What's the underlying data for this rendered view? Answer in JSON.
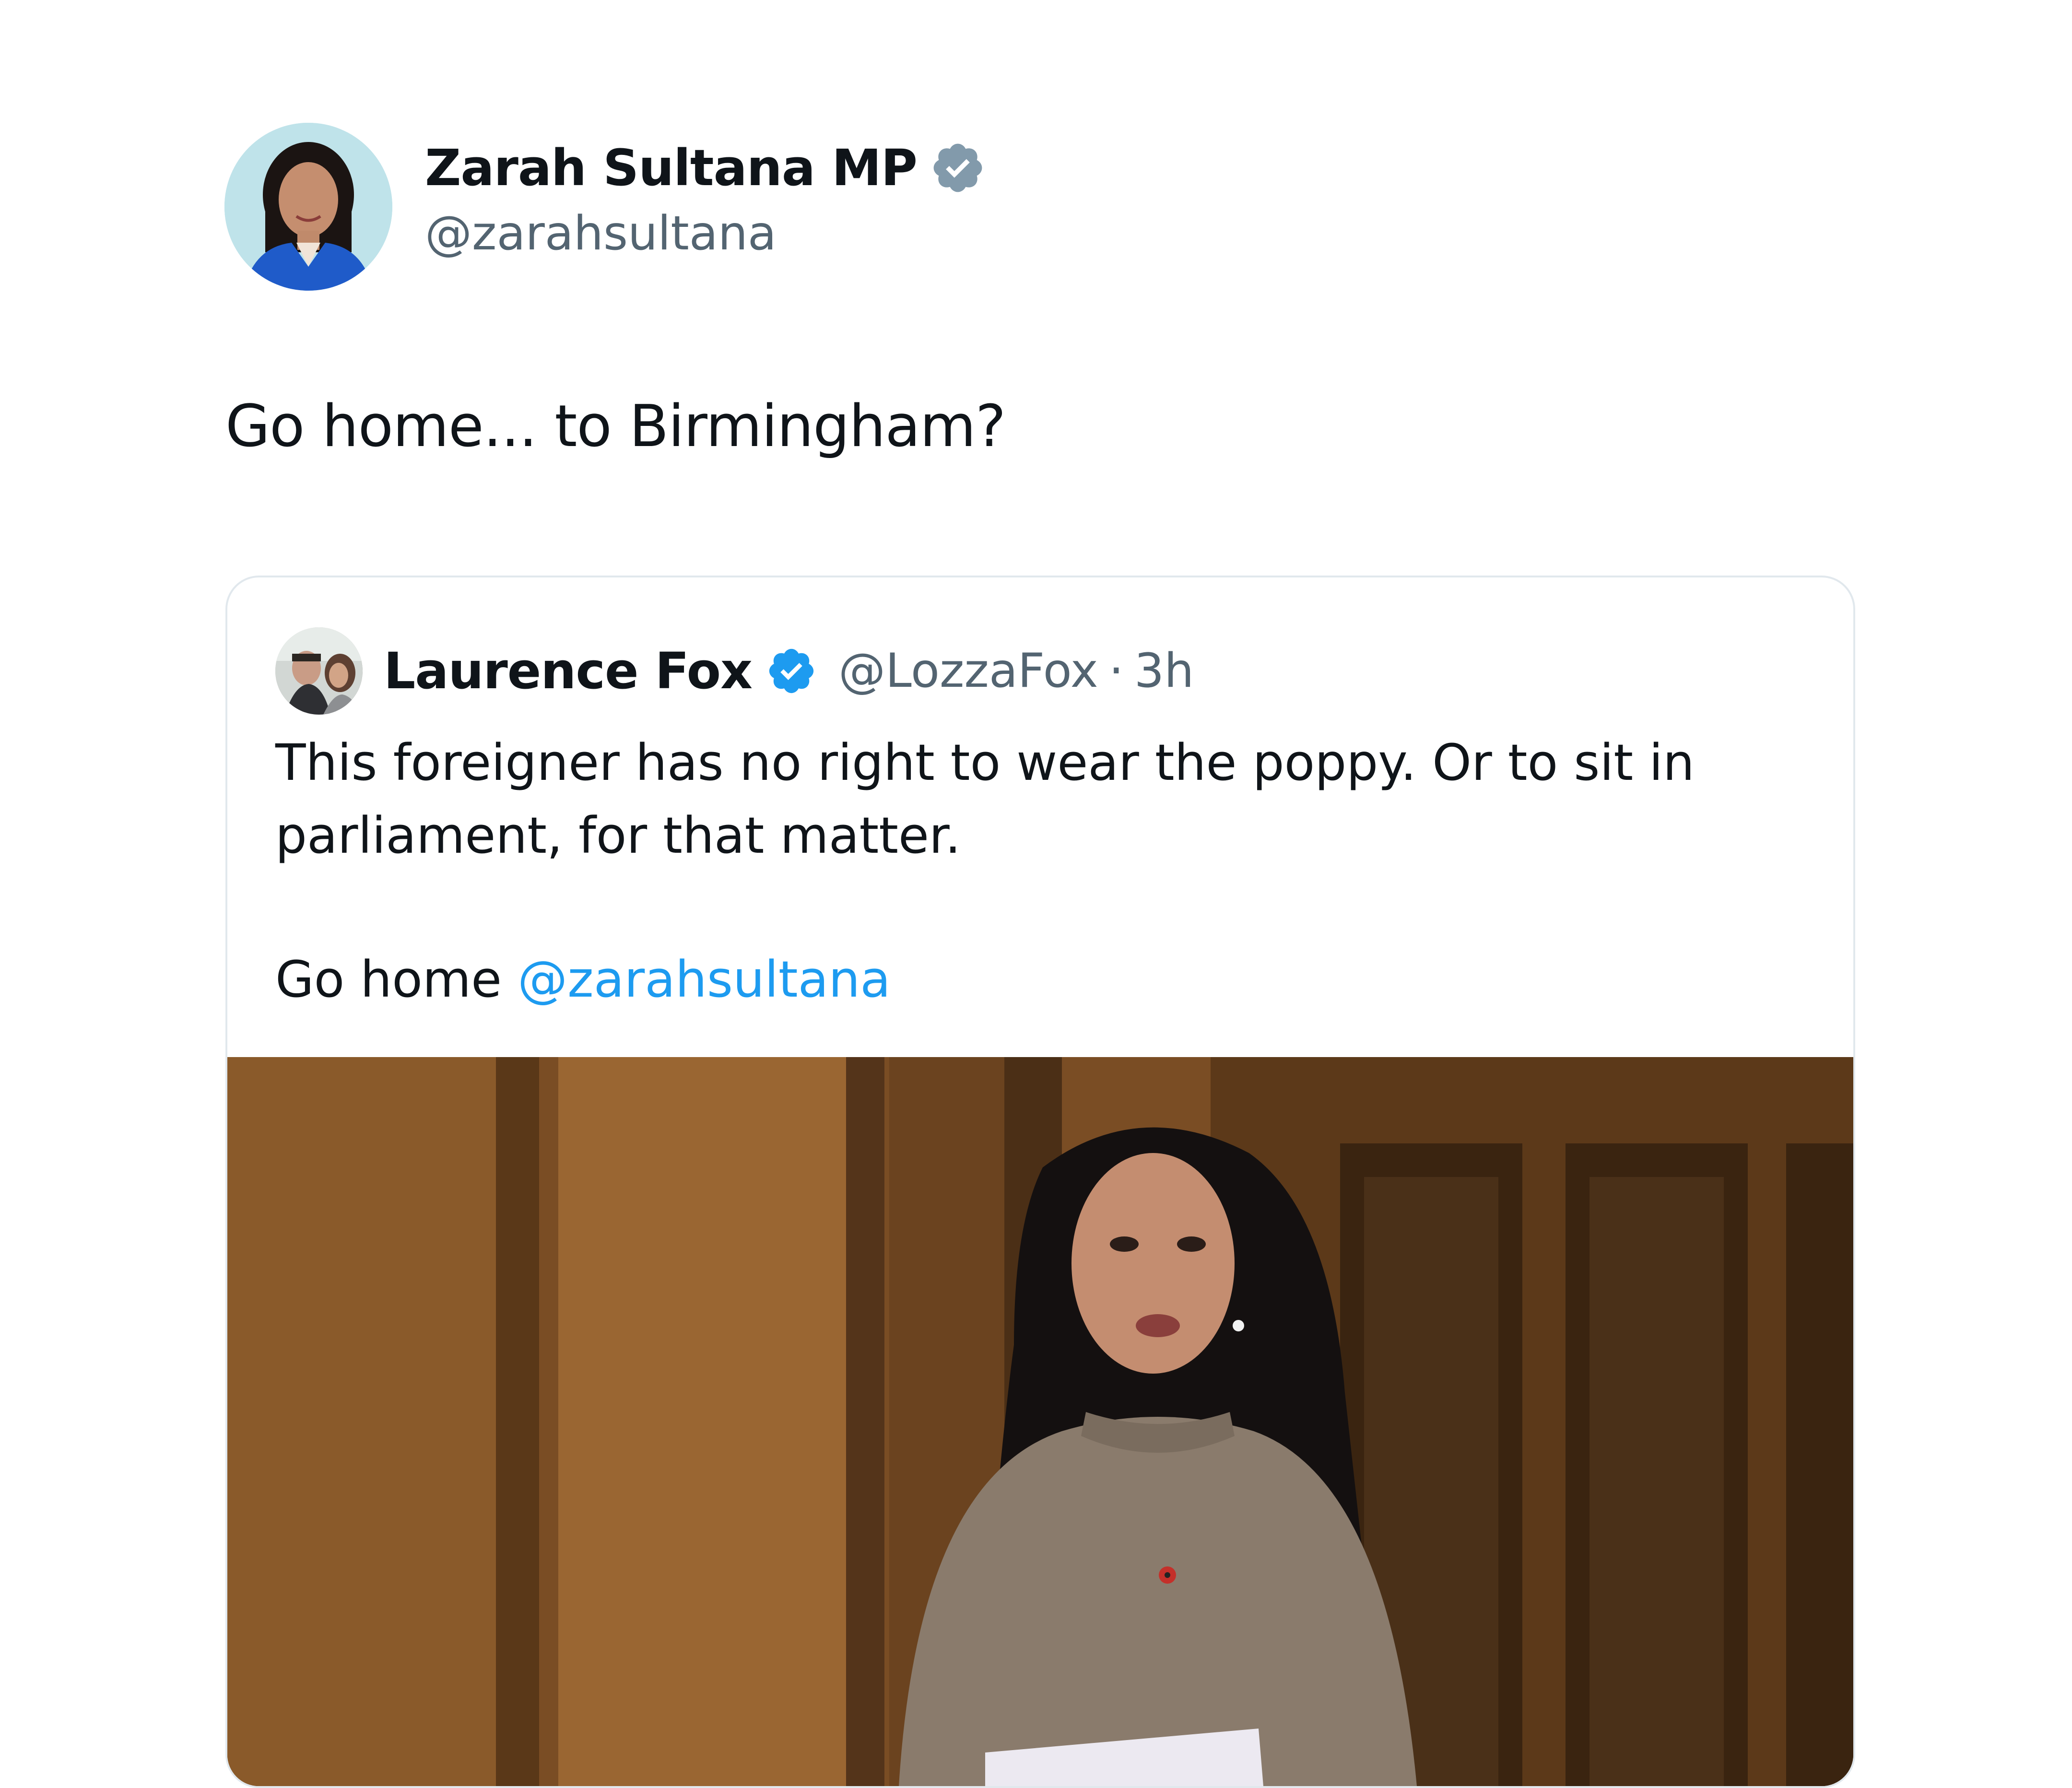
{
  "tweet": {
    "author": {
      "name": "Zarah Sultana MP",
      "handle": "@zarahsultana",
      "verified_badge": "grey-verified-icon"
    },
    "text": "Go home... to Birmingham?"
  },
  "quoted_tweet": {
    "author": {
      "name": "Laurence Fox",
      "handle": "@LozzaFox",
      "verified_badge": "blue-verified-icon"
    },
    "separator": "·",
    "time": "3h",
    "body_line1": "This foreigner has no right to wear the poppy. Or to sit in parliament, for that matter.",
    "body_line2_text": "Go home ",
    "body_line2_mention": "@zarahsultana"
  },
  "colors": {
    "mention": "#1d9bf0",
    "verified_blue": "#1d9bf0",
    "verified_grey": "#829aab",
    "secondary_text": "#536471"
  }
}
